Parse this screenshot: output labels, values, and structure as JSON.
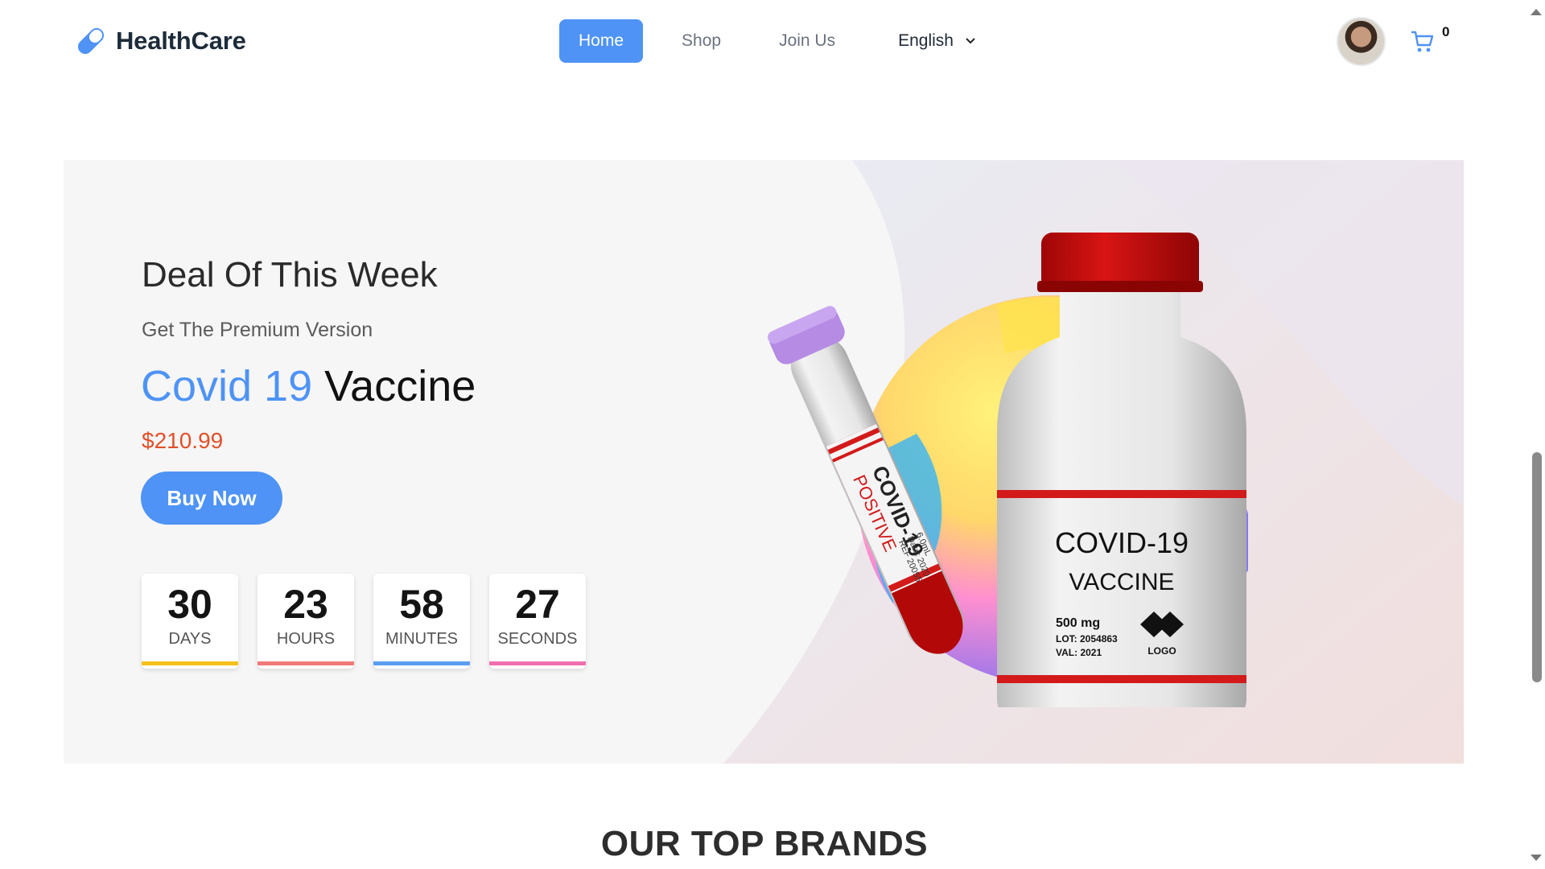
{
  "brand": {
    "name": "HealthCare"
  },
  "nav": {
    "items": [
      {
        "label": "Home",
        "active": true
      },
      {
        "label": "Shop",
        "active": false
      },
      {
        "label": "Join Us",
        "active": false
      }
    ],
    "language": "English"
  },
  "cart": {
    "count": "0"
  },
  "hero": {
    "title": "Deal Of This Week",
    "subtitle": "Get The Premium Version",
    "product_accent": "Covid 19",
    "product_rest": "Vaccine",
    "price": "$210.99",
    "buy_label": "Buy Now",
    "countdown": [
      {
        "value": "30",
        "label": "DAYS",
        "color": "#f5c01a"
      },
      {
        "value": "23",
        "label": "HOURS",
        "color": "#f07a7a"
      },
      {
        "value": "58",
        "label": "MINUTES",
        "color": "#5b9ef0"
      },
      {
        "value": "27",
        "label": "SECONDS",
        "color": "#f06fb0"
      }
    ],
    "vial": {
      "title_line1": "COVID-19",
      "title_line2": "VACCINE",
      "dose": "500 mg",
      "lot": "LOT: 2054863",
      "val": "VAL: 2021",
      "logo": "LOGO"
    },
    "tube": {
      "line1": "COVID-19",
      "line2": "POSITIVE",
      "small1": "6.0mL",
      "small2": "Date: 2020",
      "small3": "REF 20055"
    }
  },
  "brands_section": {
    "title": "OUR TOP BRANDS"
  },
  "colors": {
    "primary": "#4e93f5",
    "price": "#e0502a",
    "cap": "#c40c0c"
  }
}
